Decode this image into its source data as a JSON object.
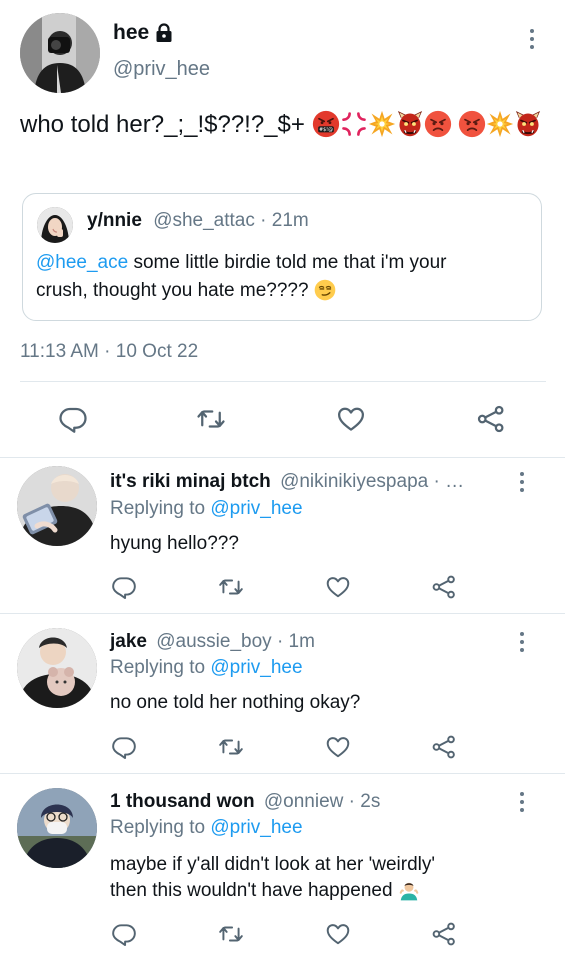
{
  "main_tweet": {
    "display_name": "hee",
    "handle": "@priv_hee",
    "text": "who told her?_;_!$??!?_$+",
    "timestamp": "11:13 AM · 10 Oct 22",
    "icons": [
      "lock-icon",
      "more-icon",
      "reply-icon",
      "retweet-icon",
      "like-icon",
      "share-icon"
    ]
  },
  "quoted_tweet": {
    "display_name": "y/nnie",
    "handle": "@she_attac",
    "age": "· 21m",
    "mention": "@hee_ace",
    "text_line1": " some little birdie told me that i'm your",
    "text_line2": "crush, thought you hate me????"
  },
  "replies": [
    {
      "display_name": "it's riki minaj btch",
      "handle": "@nikinikiyespapa · …",
      "replying_label": "Replying to",
      "replying_to": "@priv_hee",
      "text_lines": [
        "hyung hello???"
      ]
    },
    {
      "display_name": "jake",
      "handle": "@aussie_boy · 1m",
      "replying_label": "Replying to",
      "replying_to": "@priv_hee",
      "text_lines": [
        "no one told her nothing okay?"
      ]
    },
    {
      "display_name": "1 thousand won",
      "handle": "@onniew · 2s",
      "replying_label": "Replying to",
      "replying_to": "@priv_hee",
      "text_lines": [
        "maybe if y'all didn't look at her 'weirdly'",
        "then this wouldn't have happened"
      ]
    }
  ],
  "colors": {
    "link": "#1d9bf0",
    "secondary_text": "#657786",
    "divider": "#e1e8ed"
  }
}
